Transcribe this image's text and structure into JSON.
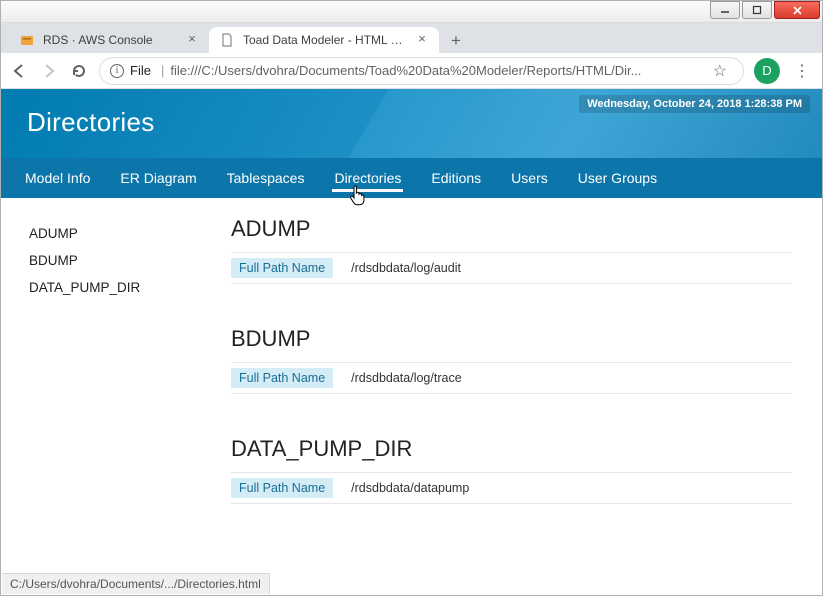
{
  "window": {
    "tabs": [
      {
        "title": "RDS · AWS Console",
        "active": false
      },
      {
        "title": "Toad Data Modeler - HTML Repo",
        "active": true
      }
    ],
    "address": {
      "scheme_label": "File",
      "url_display": "file:///C:/Users/dvohra/Documents/Toad%20Data%20Modeler/Reports/HTML/Dir..."
    },
    "avatar_letter": "D",
    "status_bar": "C:/Users/dvohra/Documents/.../Directories.html"
  },
  "page": {
    "title": "Directories",
    "timestamp": "Wednesday, October 24, 2018 1:28:38 PM",
    "menu": [
      "Model Info",
      "ER Diagram",
      "Tablespaces",
      "Directories",
      "Editions",
      "Users",
      "User Groups"
    ],
    "menu_active_index": 3,
    "sidebar_items": [
      "ADUMP",
      "BDUMP",
      "DATA_PUMP_DIR"
    ],
    "field_label": "Full Path Name",
    "directories": [
      {
        "name": "ADUMP",
        "path": "/rdsdbdata/log/audit"
      },
      {
        "name": "BDUMP",
        "path": "/rdsdbdata/log/trace"
      },
      {
        "name": "DATA_PUMP_DIR",
        "path": "/rdsdbdata/datapump"
      }
    ]
  }
}
